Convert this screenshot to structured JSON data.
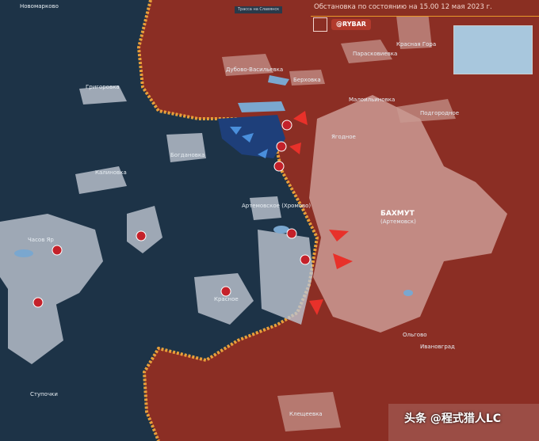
{
  "header": {
    "date_line": "Обстановка по состоянию на 15.00 12 мая 2023 г.",
    "brand": "@RYBAR",
    "title_strip": "Трасса на Славянск"
  },
  "map": {
    "places": [
      {
        "name": "Новомарково"
      },
      {
        "name": "Григоровка"
      },
      {
        "name": "Богдановка"
      },
      {
        "name": "Калиновка"
      },
      {
        "name": "Часов Яр"
      },
      {
        "name": "Красное"
      },
      {
        "name": "Артемовское (Хромово)"
      },
      {
        "name": "Дубово-Васильевка"
      },
      {
        "name": "Берховка"
      },
      {
        "name": "Парасковиевка"
      },
      {
        "name": "Малоильиновка"
      },
      {
        "name": "Подгородное"
      },
      {
        "name": "Ягодное"
      },
      {
        "name": "БАХМУТ"
      },
      {
        "name": "(Артемовск)"
      },
      {
        "name": "Ольгово"
      },
      {
        "name": "Ивановград"
      },
      {
        "name": "Ступочки"
      },
      {
        "name": "Клещеевка"
      },
      {
        "name": "Красная Гора"
      }
    ],
    "colors": {
      "ru_zone": "#8b2e24",
      "ua_zone": "#1d3347",
      "city": "#d4a9a3",
      "front": "#e8a03a",
      "water": "#7aa7cf"
    }
  },
  "watermark": "头条 @程式猎人LC"
}
